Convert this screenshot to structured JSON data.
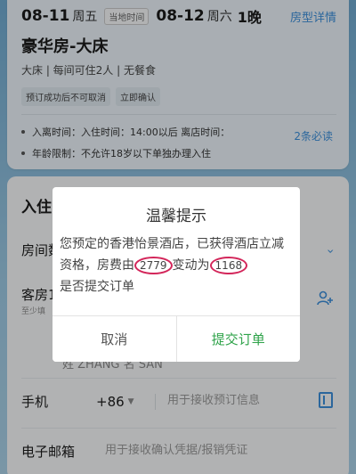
{
  "hotel_card": {
    "checkin_date": "08-11",
    "checkin_weekday": "周五",
    "local_time_tag": "当地时间",
    "checkout_date": "08-12",
    "checkout_weekday": "周六",
    "nights": "1晚",
    "room_detail_link": "房型详情",
    "room_name": "豪华房-大床",
    "room_attrs": "大床 | 每间可住2人 | 无餐食",
    "tags": [
      "预订成功后不可取消",
      "立即确认"
    ],
    "info_lines": [
      "入离时间：入住时间：14:00以后  离店时间：",
      "年龄限制：不允许18岁以下单独办理入住"
    ],
    "more_link": "2条必读"
  },
  "form": {
    "section_title": "入住",
    "room_count_label": "房间数",
    "guest_label": "客房1",
    "guest_sub": "至少填",
    "name_hint": "姓 ZHANG    名 SAN",
    "phone_label": "手机",
    "phone_code": "+86",
    "phone_placeholder": "用于接收预订信息",
    "email_label": "电子邮箱",
    "email_placeholder": "用于接收确认凭据/报销凭证"
  },
  "dialog": {
    "title": "温馨提示",
    "msg_part1": "您预定的香港怡景酒店，已获得酒店立减资格，房费由",
    "old_price": "2779",
    "msg_part2": "变动为",
    "new_price": "1168",
    "msg_part3": "是否提交订单",
    "cancel_label": "取消",
    "submit_label": "提交订单"
  },
  "colors": {
    "accent_blue": "#3c8ed9",
    "submit_green": "#2fa34a",
    "price_circle": "#d3265a"
  }
}
